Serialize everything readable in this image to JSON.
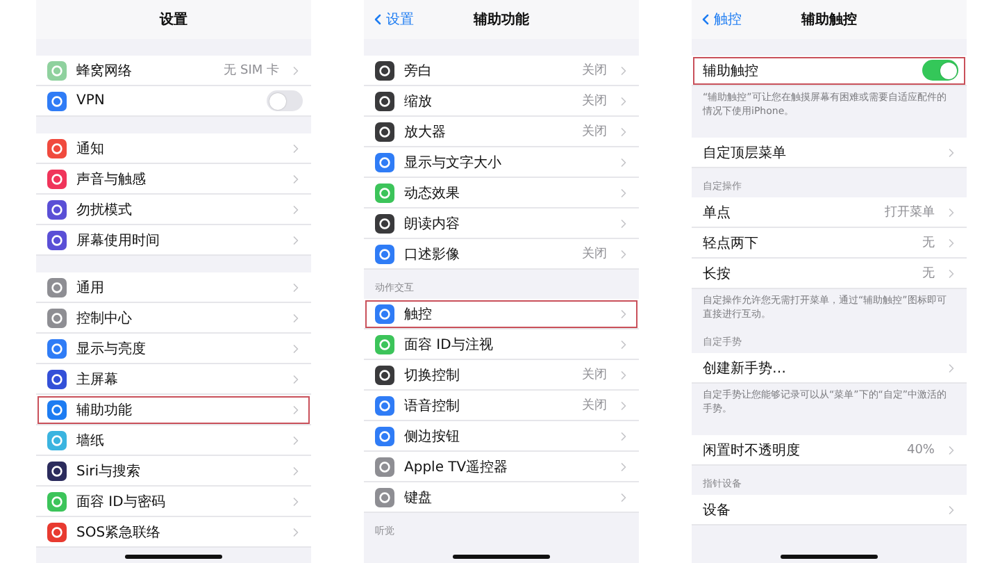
{
  "panels": [
    {
      "title": "设置",
      "sections": [
        {
          "rows": [
            {
              "label": "蜂窝网络",
              "value": "无 SIM 卡",
              "kind": "chevron",
              "color": "#8fd19e",
              "highlighted": false
            },
            {
              "label": "VPN",
              "kind": "toggle",
              "on": false,
              "color": "#2f7cf6",
              "highlighted": false
            }
          ]
        },
        {
          "rows": [
            {
              "label": "通知",
              "kind": "chevron",
              "color": "#f04a3e",
              "highlighted": false
            },
            {
              "label": "声音与触感",
              "kind": "chevron",
              "color": "#f0345a",
              "highlighted": false
            },
            {
              "label": "勿扰模式",
              "kind": "chevron",
              "color": "#5a4fd6",
              "highlighted": false
            },
            {
              "label": "屏幕使用时间",
              "kind": "chevron",
              "color": "#5a4fd6",
              "highlighted": false
            }
          ]
        },
        {
          "rows": [
            {
              "label": "通用",
              "kind": "chevron",
              "color": "#8e8e93",
              "highlighted": false
            },
            {
              "label": "控制中心",
              "kind": "chevron",
              "color": "#8e8e93",
              "highlighted": false
            },
            {
              "label": "显示与亮度",
              "kind": "chevron",
              "color": "#2f7cf6",
              "highlighted": false
            },
            {
              "label": "主屏幕",
              "kind": "chevron",
              "color": "#3350d8",
              "highlighted": false
            },
            {
              "label": "辅助功能",
              "kind": "chevron",
              "color": "#1d7cf2",
              "highlighted": true
            },
            {
              "label": "墙纸",
              "kind": "chevron",
              "color": "#3ab4e0",
              "highlighted": false
            },
            {
              "label": "Siri与搜索",
              "kind": "chevron",
              "color": "#2b2b5c",
              "highlighted": false
            },
            {
              "label": "面容 ID与密码",
              "kind": "chevron",
              "color": "#3cc45a",
              "highlighted": false
            },
            {
              "label": "SOS紧急联络",
              "kind": "chevron",
              "color": "#e83a30",
              "highlighted": false
            }
          ]
        }
      ]
    },
    {
      "title": "辅助功能",
      "back": "设置",
      "sections": [
        {
          "rows": [
            {
              "label": "旁白",
              "value": "关闭",
              "kind": "chevron",
              "color": "#3a3a3c",
              "highlighted": false
            },
            {
              "label": "缩放",
              "value": "关闭",
              "kind": "chevron",
              "color": "#3a3a3c",
              "highlighted": false
            },
            {
              "label": "放大器",
              "value": "关闭",
              "kind": "chevron",
              "color": "#3a3a3c",
              "highlighted": false
            },
            {
              "label": "显示与文字大小",
              "kind": "chevron",
              "color": "#2f7cf6",
              "highlighted": false
            },
            {
              "label": "动态效果",
              "kind": "chevron",
              "color": "#3cc45a",
              "highlighted": false
            },
            {
              "label": "朗读内容",
              "kind": "chevron",
              "color": "#3a3a3c",
              "highlighted": false
            },
            {
              "label": "口述影像",
              "value": "关闭",
              "kind": "chevron",
              "color": "#2f7cf6",
              "highlighted": false
            }
          ]
        },
        {
          "header": "动作交互",
          "rows": [
            {
              "label": "触控",
              "kind": "chevron",
              "color": "#2f7cf6",
              "highlighted": true
            },
            {
              "label": "面容 ID与注视",
              "kind": "chevron",
              "color": "#3cc45a",
              "highlighted": false
            },
            {
              "label": "切换控制",
              "value": "关闭",
              "kind": "chevron",
              "color": "#3a3a3c",
              "highlighted": false
            },
            {
              "label": "语音控制",
              "value": "关闭",
              "kind": "chevron",
              "color": "#2f7cf6",
              "highlighted": false
            },
            {
              "label": "侧边按钮",
              "kind": "chevron",
              "color": "#2f7cf6",
              "highlighted": false
            },
            {
              "label": "Apple TV遥控器",
              "kind": "chevron",
              "color": "#8e8e93",
              "highlighted": false
            },
            {
              "label": "键盘",
              "kind": "chevron",
              "color": "#8e8e93",
              "highlighted": false
            }
          ]
        },
        {
          "header": "听觉"
        }
      ]
    },
    {
      "title": "辅助触控",
      "back": "触控",
      "sections": [
        {
          "rows": [
            {
              "label": "辅助触控",
              "kind": "toggle",
              "on": true,
              "highlighted": true
            }
          ],
          "footer": "“辅助触控”可让您在触摸屏幕有困难或需要自适应配件的情况下使用iPhone。"
        },
        {
          "rows": [
            {
              "label": "自定顶层菜单",
              "kind": "chevron",
              "highlighted": false
            }
          ]
        },
        {
          "header": "自定操作",
          "rows": [
            {
              "label": "单点",
              "value": "打开菜单",
              "kind": "chevron",
              "highlighted": false
            },
            {
              "label": "轻点两下",
              "value": "无",
              "kind": "chevron",
              "highlighted": false
            },
            {
              "label": "长按",
              "value": "无",
              "kind": "chevron",
              "highlighted": false
            }
          ],
          "footer": "自定操作允许您无需打开菜单，通过“辅助触控”图标即可直接进行互动。"
        },
        {
          "header": "自定手势",
          "rows": [
            {
              "label": "创建新手势…",
              "kind": "chevron",
              "highlighted": false
            }
          ],
          "footer": "自定手势让您能够记录可以从“菜单”下的“自定”中激活的手势。"
        },
        {
          "rows": [
            {
              "label": "闲置时不透明度",
              "value": "40%",
              "kind": "chevron",
              "highlighted": false
            }
          ]
        },
        {
          "header": "指针设备",
          "rows": [
            {
              "label": "设备",
              "kind": "chevron",
              "highlighted": false
            }
          ]
        }
      ]
    }
  ]
}
